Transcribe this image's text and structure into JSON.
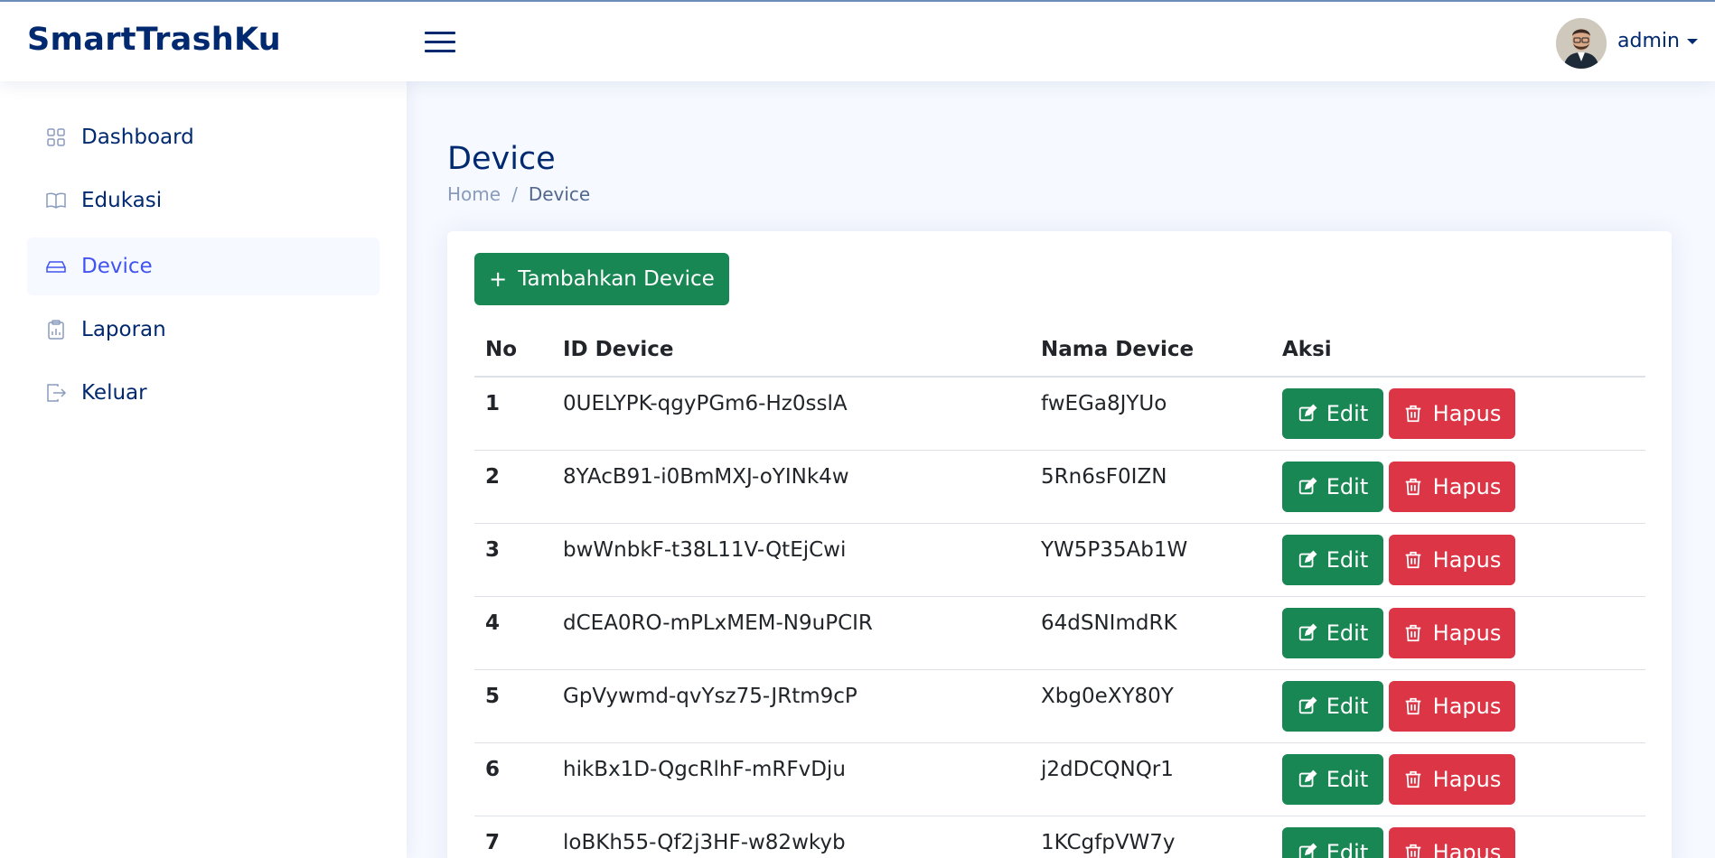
{
  "app": {
    "logo": "SmartTrashKu"
  },
  "header": {
    "user_name": "admin"
  },
  "sidebar": {
    "items": [
      {
        "label": "Dashboard",
        "icon": "grid-icon",
        "active": false
      },
      {
        "label": "Edukasi",
        "icon": "book-icon",
        "active": false
      },
      {
        "label": "Device",
        "icon": "hdd-icon",
        "active": true
      },
      {
        "label": "Laporan",
        "icon": "clipboard-data-icon",
        "active": false
      },
      {
        "label": "Keluar",
        "icon": "box-arrow-right-icon",
        "active": false
      }
    ]
  },
  "page": {
    "title": "Device",
    "breadcrumb": {
      "home": "Home",
      "separator": "/",
      "current": "Device"
    }
  },
  "actions": {
    "add_label": "Tambahkan Device",
    "edit_label": "Edit",
    "delete_label": "Hapus"
  },
  "table": {
    "columns": [
      "No",
      "ID Device",
      "Nama Device",
      "Aksi"
    ],
    "rows": [
      {
        "no": "1",
        "id": "0UELYPK-qgyPGm6-Hz0sslA",
        "name": "fwEGa8JYUo"
      },
      {
        "no": "2",
        "id": "8YAcB91-i0BmMXJ-oYINk4w",
        "name": "5Rn6sF0IZN"
      },
      {
        "no": "3",
        "id": "bwWnbkF-t38L11V-QtEjCwi",
        "name": "YW5P35Ab1W"
      },
      {
        "no": "4",
        "id": "dCEA0RO-mPLxMEM-N9uPCIR",
        "name": "64dSNImdRK"
      },
      {
        "no": "5",
        "id": "GpVywmd-qvYsz75-JRtm9cP",
        "name": "Xbg0eXY80Y"
      },
      {
        "no": "6",
        "id": "hikBx1D-QgcRlhF-mRFvDju",
        "name": "j2dDCQNQr1"
      },
      {
        "no": "7",
        "id": "loBKh55-Qf2j3HF-w82wkyb",
        "name": "1KCgfpVW7y"
      }
    ]
  },
  "colors": {
    "brand": "#012970",
    "accent": "#4154f1",
    "success": "#198754",
    "danger": "#dc3545"
  }
}
